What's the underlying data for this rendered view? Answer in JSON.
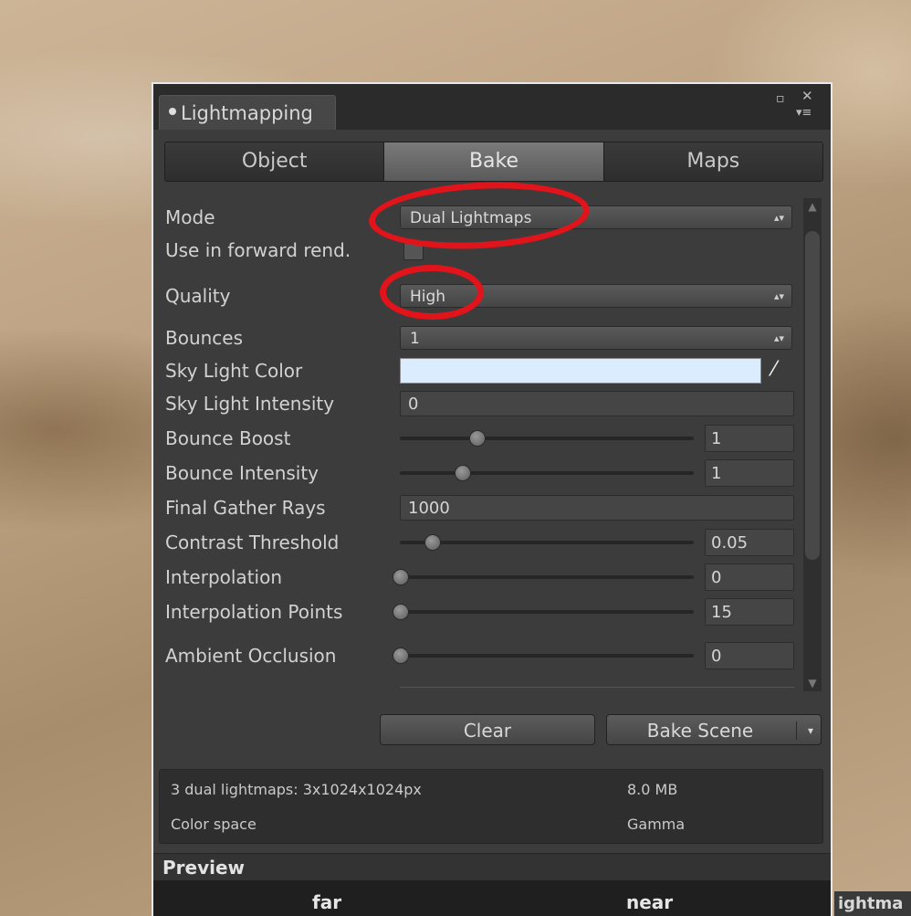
{
  "window": {
    "tab_title": "Lightmapping",
    "maximize_glyph": "▫",
    "close_glyph": "✕",
    "menu_glyph": "▾≡"
  },
  "tabs": [
    {
      "label": "Object",
      "active": false
    },
    {
      "label": "Bake",
      "active": true
    },
    {
      "label": "Maps",
      "active": false
    }
  ],
  "bake": {
    "mode": {
      "label": "Mode",
      "value": "Dual Lightmaps"
    },
    "forward": {
      "label": "Use in forward rend.",
      "checked": false
    },
    "quality": {
      "label": "Quality",
      "value": "High"
    },
    "bounces": {
      "label": "Bounces",
      "value": "1"
    },
    "sky_color": {
      "label": "Sky Light Color",
      "color": "#dcecff"
    },
    "sky_intensity": {
      "label": "Sky Light Intensity",
      "value": "0"
    },
    "bounce_boost": {
      "label": "Bounce Boost",
      "value": "1",
      "fraction": 0.26
    },
    "bounce_intensity": {
      "label": "Bounce Intensity",
      "value": "1",
      "fraction": 0.21
    },
    "final_gather": {
      "label": "Final Gather Rays",
      "value": "1000"
    },
    "contrast": {
      "label": "Contrast Threshold",
      "value": "0.05",
      "fraction": 0.11
    },
    "interpolation": {
      "label": "Interpolation",
      "value": "0",
      "fraction": 0.0
    },
    "interp_points": {
      "label": "Interpolation Points",
      "value": "15",
      "fraction": 0.0
    },
    "ambient_occlusion": {
      "label": "Ambient Occlusion",
      "value": "0",
      "fraction": 0.0
    }
  },
  "buttons": {
    "clear": "Clear",
    "bake_scene": "Bake Scene",
    "dropdown_glyph": "▾"
  },
  "info": {
    "lightmaps_text": "3 dual lightmaps: 3x1024x1024px",
    "size": "8.0 MB",
    "color_space_label": "Color space",
    "color_space_value": "Gamma"
  },
  "preview": {
    "header": "Preview",
    "far": "far",
    "near": "near"
  },
  "background_text": "ightma",
  "highlight_color": "#e0141a"
}
